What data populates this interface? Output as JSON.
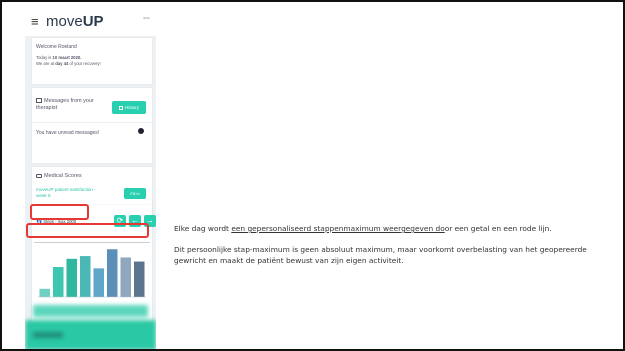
{
  "app": {
    "logo_light": "move",
    "logo_bold": "UP",
    "top_right_text": "ENG"
  },
  "welcome": {
    "greeting": "Welcome Roeland",
    "today_prefix": "Today is ",
    "today_date": "10 maart 2020.",
    "recovery_prefix": "We are at ",
    "recovery_day": "day 44",
    "recovery_suffix": " of your recovery!"
  },
  "messages": {
    "title": "Messages from your therapist",
    "history_label": "History",
    "unread_text": "You have unread messages!"
  },
  "medical_scores": {
    "title": "Medical Scores",
    "item_label": "moveUP patient satisfaction - week 6",
    "fill_in_label": "Fill in",
    "video_request": "1 new video request",
    "status": "Not Yet Recorded"
  },
  "steps": {
    "label": "Steps - max 2000"
  },
  "chart_data": {
    "type": "bar",
    "categories": [
      "",
      "",
      "",
      "",
      "",
      "",
      "",
      ""
    ],
    "values": [
      300,
      1100,
      1400,
      1500,
      1050,
      1750,
      1450,
      1300
    ],
    "max_line": 2000,
    "ylim": [
      0,
      2200
    ],
    "bar_colors": [
      "#6fd1c2",
      "#3fc6b1",
      "#2fb89f",
      "#4bb8b5",
      "#5fa6c9",
      "#5b8fb8",
      "#8fa7bf",
      "#5d7390"
    ],
    "max_line_color": "#e53935"
  },
  "description": {
    "p1_before": "Elke dag wordt ",
    "p1_underlined": "een gepersonaliseerd stappenmaximum weergegeven do",
    "p1_after": "or een getal en een rode lijn.",
    "p2": "Dit persoonlijke stap-maximum is geen absoluut maximum, maar voorkomt overbelasting van het geopereerde gewricht en maakt de patiënt bewust van zijn eigen activiteit."
  }
}
